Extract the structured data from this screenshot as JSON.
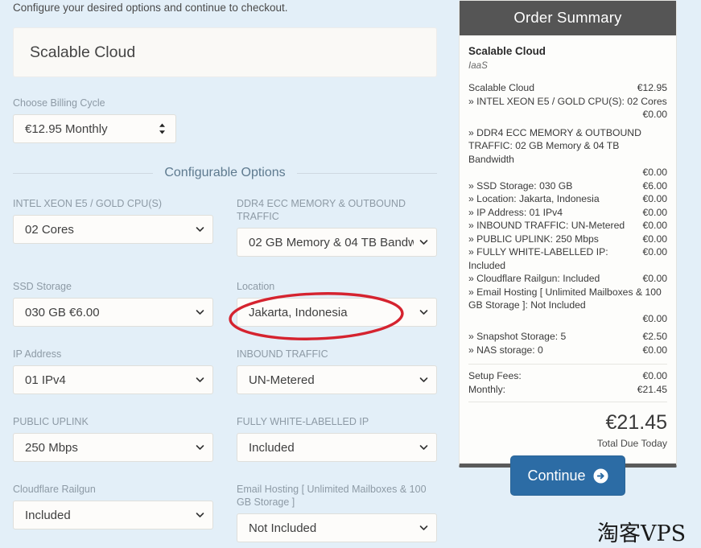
{
  "intro": {
    "text": "Configure your desired options and continue to checkout."
  },
  "product": {
    "name": "Scalable Cloud"
  },
  "billing": {
    "label": "Choose Billing Cycle",
    "value": "€12.95 Monthly"
  },
  "section": {
    "configurable_options": "Configurable Options"
  },
  "options": [
    {
      "label": "INTEL XEON E5 / GOLD CPU(S)",
      "value": "02 Cores"
    },
    {
      "label": "DDR4 ECC MEMORY & OUTBOUND TRAFFIC",
      "value": "02 GB Memory & 04 TB Bandwidth"
    },
    {
      "label": "SSD Storage",
      "value": "030 GB €6.00"
    },
    {
      "label": "Location",
      "value": "Jakarta, Indonesia"
    },
    {
      "label": "IP Address",
      "value": "01 IPv4"
    },
    {
      "label": "INBOUND TRAFFIC",
      "value": "UN-Metered"
    },
    {
      "label": "PUBLIC UPLINK",
      "value": "250 Mbps"
    },
    {
      "label": "FULLY WHITE-LABELLED IP",
      "value": "Included"
    },
    {
      "label": "Cloudflare Railgun",
      "value": "Included"
    },
    {
      "label": "Email Hosting [ Unlimited Mailboxes & 100 GB Storage ]",
      "value": "Not Included"
    }
  ],
  "summary": {
    "heading": "Order Summary",
    "product_name": "Scalable Cloud",
    "product_type": "IaaS",
    "base_label": "Scalable Cloud",
    "base_amount": "€12.95",
    "items": [
      {
        "label": "» INTEL XEON E5 / GOLD CPU(S): 02 Cores",
        "amount": "€0.00",
        "wrapped": true
      },
      {
        "label": "» DDR4 ECC MEMORY & OUTBOUND TRAFFIC: 02 GB Memory & 04 TB Bandwidth",
        "amount": "€0.00",
        "wrapped": true
      },
      {
        "label": "» SSD Storage: 030 GB",
        "amount": "€6.00",
        "wrapped": false
      },
      {
        "label": "» Location: Jakarta, Indonesia",
        "amount": "€0.00",
        "wrapped": false
      },
      {
        "label": "» IP Address: 01 IPv4",
        "amount": "€0.00",
        "wrapped": false
      },
      {
        "label": "» INBOUND TRAFFIC: UN-Metered",
        "amount": "€0.00",
        "wrapped": false
      },
      {
        "label": "» PUBLIC UPLINK: 250 Mbps",
        "amount": "€0.00",
        "wrapped": false
      },
      {
        "label": "» FULLY WHITE-LABELLED IP: Included",
        "amount": "€0.00",
        "wrapped": false
      },
      {
        "label": "» Cloudflare Railgun: Included",
        "amount": "€0.00",
        "wrapped": false
      },
      {
        "label": "» Email Hosting [ Unlimited Mailboxes & 100 GB Storage ]: Not Included",
        "amount": "€0.00",
        "wrapped": true
      },
      {
        "label": "» Snapshot Storage: 5",
        "amount": "€2.50",
        "wrapped": false
      },
      {
        "label": "» NAS storage: 0",
        "amount": "€0.00",
        "wrapped": false
      }
    ],
    "setup_fees_label": "Setup Fees:",
    "setup_fees_amount": "€0.00",
    "monthly_label": "Monthly:",
    "monthly_amount": "€21.45",
    "total_amount": "€21.45",
    "total_label": "Total Due Today"
  },
  "continue_button": {
    "label": "Continue"
  },
  "watermark": {
    "text": "淘客VPS"
  },
  "colors": {
    "page_background": "#e3eff8",
    "summary_header": "#555555",
    "continue_button": "#2c6ca5",
    "section_heading": "#5e7a8f",
    "annotation_red": "#d5232f"
  }
}
